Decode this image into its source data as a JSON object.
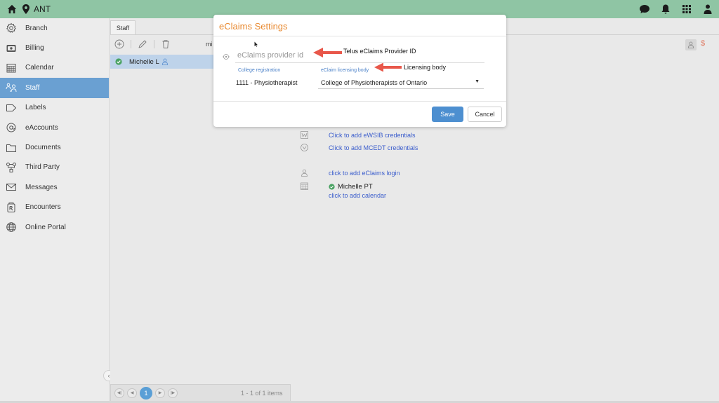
{
  "topbar": {
    "branch_name": "ANT",
    "bg_color": "#8fc5a4",
    "icons": [
      "home-icon",
      "location-pin-icon",
      "chat-icon",
      "bell-icon",
      "grid-icon",
      "user-icon"
    ]
  },
  "sidebar": {
    "active_color": "#6aa0d2",
    "items": [
      {
        "label": "Branch",
        "icon": "gear-icon"
      },
      {
        "label": "Billing",
        "icon": "card-icon"
      },
      {
        "label": "Calendar",
        "icon": "calendar-icon"
      },
      {
        "label": "Staff",
        "icon": "people-icon",
        "active": true
      },
      {
        "label": "Labels",
        "icon": "tag-icon"
      },
      {
        "label": "eAccounts",
        "icon": "at-icon"
      },
      {
        "label": "Documents",
        "icon": "folder-icon"
      },
      {
        "label": "Third Party",
        "icon": "network-icon"
      },
      {
        "label": "Messages",
        "icon": "mail-icon"
      },
      {
        "label": "Encounters",
        "icon": "rx-icon"
      },
      {
        "label": "Online Portal",
        "icon": "globe-icon"
      }
    ]
  },
  "staff_panel": {
    "tab_label": "Staff",
    "search_fragment": "mi",
    "rows": [
      {
        "name": "Michelle L"
      }
    ],
    "pager": {
      "current_page": "1",
      "info": "1 - 1 of 1 items"
    }
  },
  "detail": {
    "links": {
      "ewsib": "Click to add eWSIB credentials",
      "mcedt": "Click to add MCEDT credentials",
      "eclaims_login": "click to add eClaims login"
    },
    "calendar": {
      "name": "Michelle PT",
      "add_link": "click to add calendar"
    },
    "dollar_badge": "$"
  },
  "modal": {
    "title": "eClaims Settings",
    "title_color": "#e8892f",
    "provider_placeholder": "eClaims provider id",
    "provider_value": "",
    "college_registration_label": "College registration",
    "college_registration_value": "1111 - Physiotherapist",
    "licensing_body_label": "eClaim licensing body",
    "licensing_body_value": "College of Physiotherapists of Ontario",
    "save_label": "Save",
    "cancel_label": "Cancel",
    "save_color": "#4d8fd0"
  },
  "annotations": {
    "provider_id": "Telus eClaims Provider ID",
    "licensing_body": "Licensing body",
    "arrow_color": "#e8574a"
  }
}
